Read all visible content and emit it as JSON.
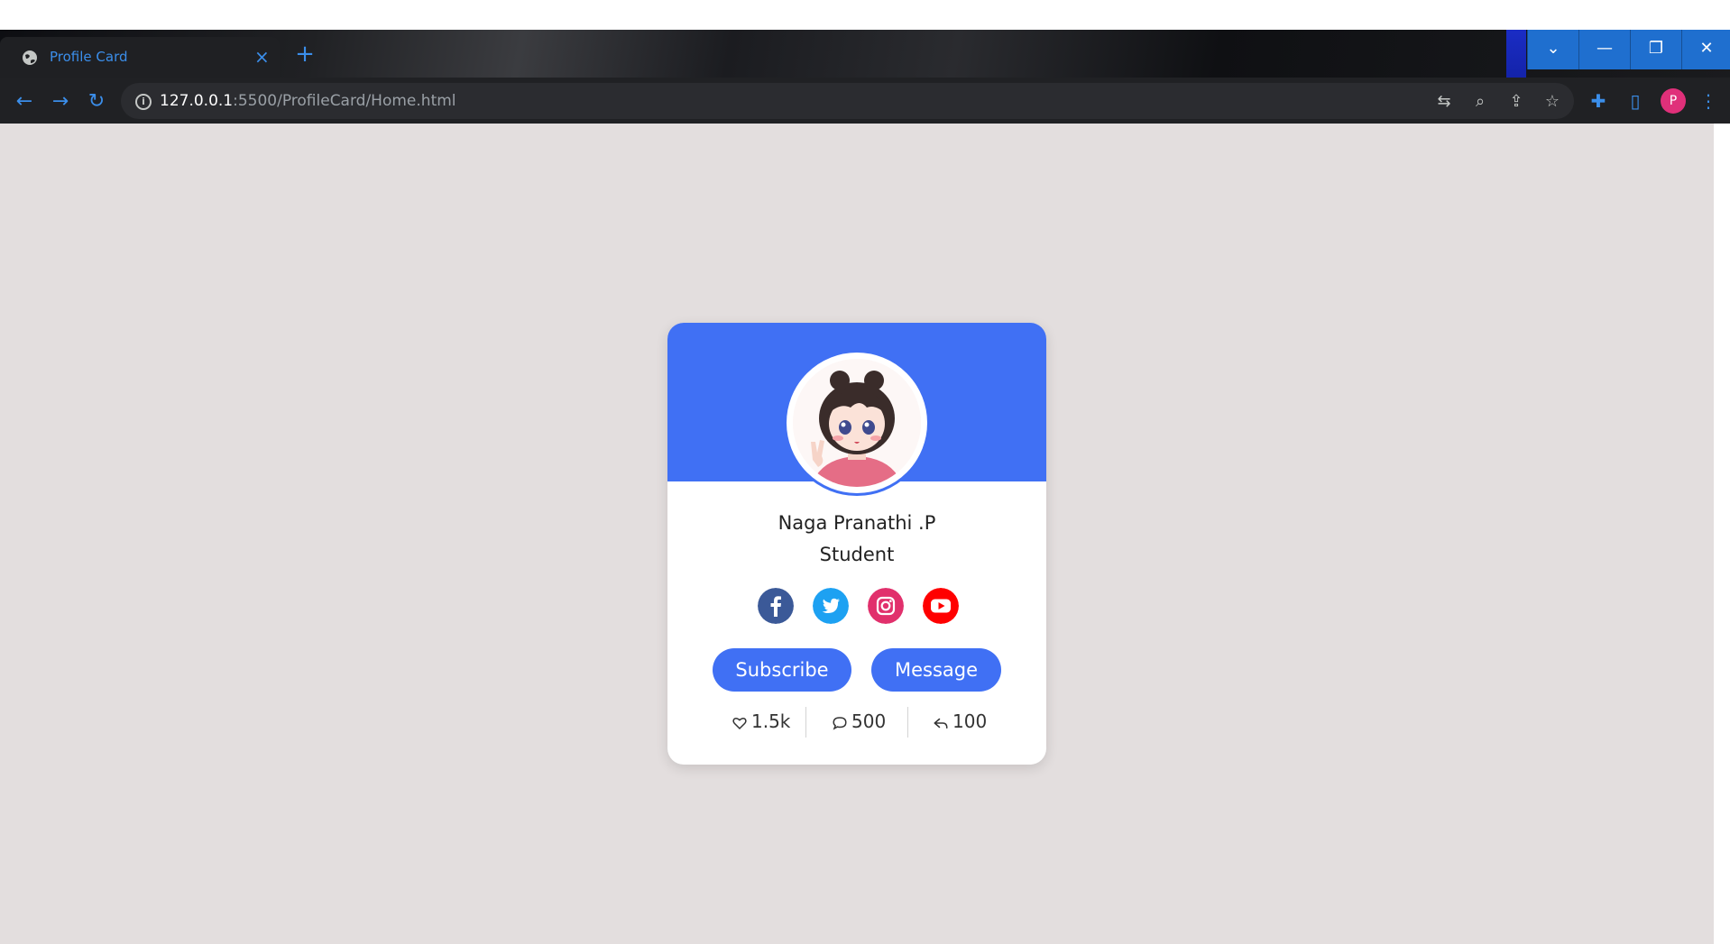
{
  "browser": {
    "tab_title": "Profile Card",
    "tab_close": "×",
    "new_tab": "+",
    "url_host": "127.0.0.1",
    "url_path": ":5500/ProfileCard/Home.html",
    "profile_initial": "P",
    "icons": [
      "globe-icon",
      "back-icon",
      "forward-icon",
      "reload-icon",
      "info-icon",
      "translate-icon",
      "zoom-icon",
      "share-icon",
      "star-icon",
      "extensions-icon",
      "side-panel-icon",
      "menu-icon"
    ]
  },
  "window_controls": {
    "dropdown": "⌄",
    "minimize": "—",
    "restore": "❐",
    "close": "✕"
  },
  "profile": {
    "name": "Naga Pranathi .P",
    "role": "Student",
    "socials": [
      {
        "name": "facebook",
        "color": "#3b5998"
      },
      {
        "name": "twitter",
        "color": "#1da1f2"
      },
      {
        "name": "instagram",
        "color": "#e1306c"
      },
      {
        "name": "youtube",
        "color": "#ff0000"
      }
    ],
    "buttons": {
      "subscribe": "Subscribe",
      "message": "Message"
    },
    "stats": {
      "likes": "1.5k",
      "comments": "500",
      "shares": "100"
    }
  },
  "colors": {
    "accent": "#4070f4",
    "page_bg": "#e3dede"
  }
}
